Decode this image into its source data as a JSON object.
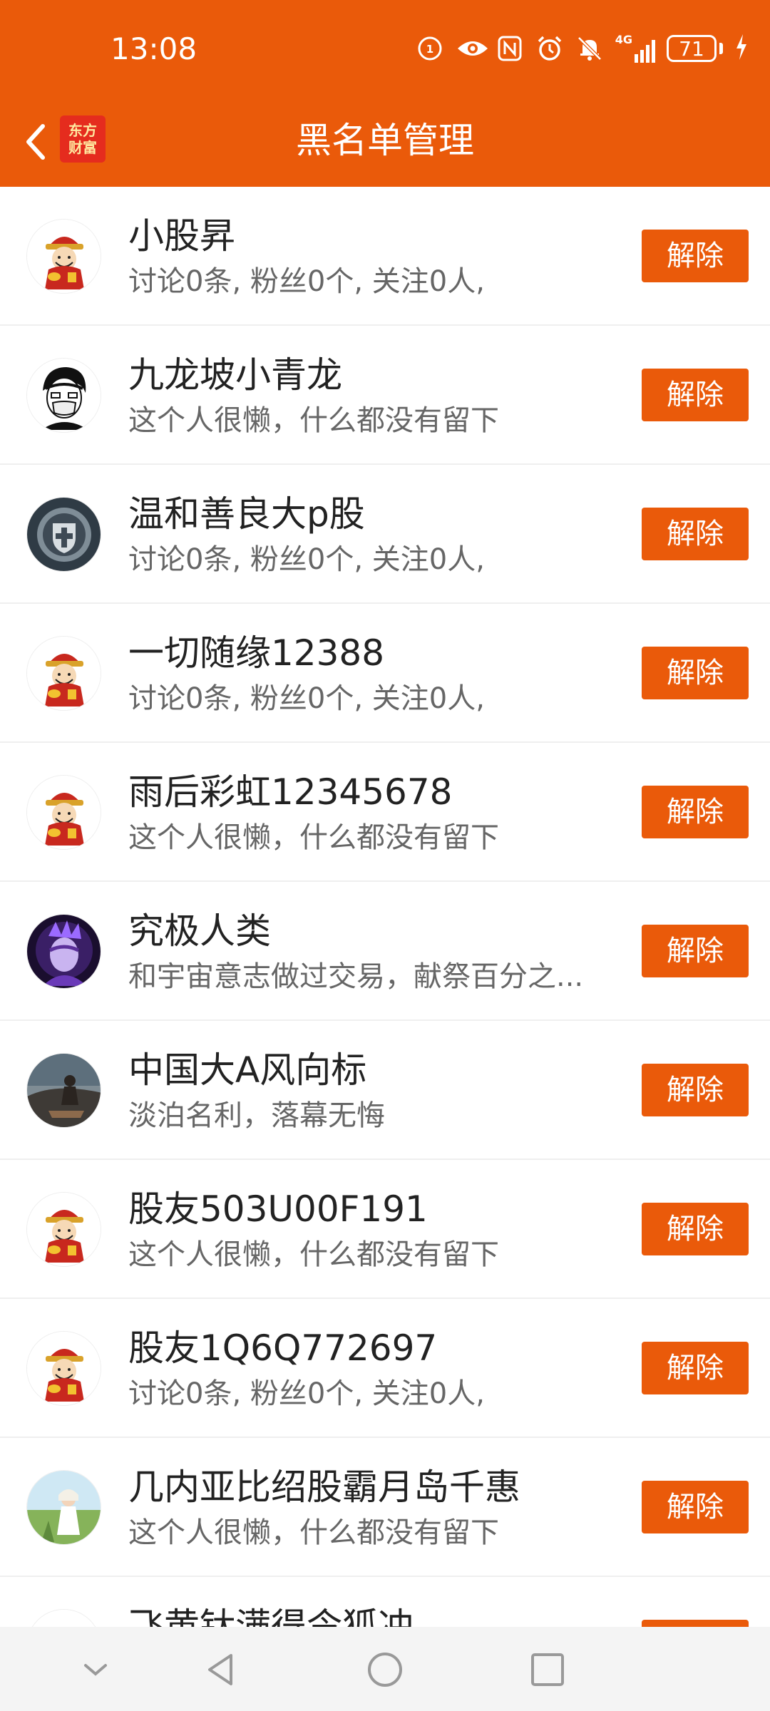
{
  "status_bar": {
    "time": "13:08",
    "network": "4G",
    "battery": "71",
    "icons": [
      "hd-call-icon",
      "eye-icon",
      "nfc-icon",
      "alarm-icon",
      "mute-icon",
      "signal-icon",
      "battery-icon",
      "charging-icon"
    ]
  },
  "header": {
    "title": "黑名单管理",
    "logo_line1": "东方",
    "logo_line2": "财富",
    "accent": "#EA5A0A"
  },
  "list": {
    "remove_label": "解除",
    "items": [
      {
        "name": "小股昇",
        "desc": "讨论0条, 粉丝0个, 关注0人,",
        "avatar": "fortune-god"
      },
      {
        "name": "九龙坡小青龙",
        "desc": "这个人很懒，什么都没有留下",
        "avatar": "masked-face"
      },
      {
        "name": "温和善良大p股",
        "desc": "讨论0条, 粉丝0个, 关注0人,",
        "avatar": "emblem"
      },
      {
        "name": "一切随缘12388",
        "desc": "讨论0条, 粉丝0个, 关注0人,",
        "avatar": "fortune-god"
      },
      {
        "name": "雨后彩虹12345678",
        "desc": "这个人很懒，什么都没有留下",
        "avatar": "fortune-god"
      },
      {
        "name": "究极人类",
        "desc": "和宇宙意志做过交易，献祭百分之...",
        "avatar": "purple-figure"
      },
      {
        "name": "中国大A风向标",
        "desc": "淡泊名利，落幕无悔",
        "avatar": "photo-person"
      },
      {
        "name": "股友503U00F191",
        "desc": "这个人很懒，什么都没有留下",
        "avatar": "fortune-god"
      },
      {
        "name": "股友1Q6Q772697",
        "desc": "讨论0条, 粉丝0个, 关注0人,",
        "avatar": "fortune-god"
      },
      {
        "name": "几内亚比绍股霸月岛千惠",
        "desc": "这个人很懒，什么都没有留下",
        "avatar": "field-girl"
      },
      {
        "name": "飞黄钛满得令狐冲",
        "desc": "",
        "avatar": "fortune-god"
      }
    ]
  }
}
